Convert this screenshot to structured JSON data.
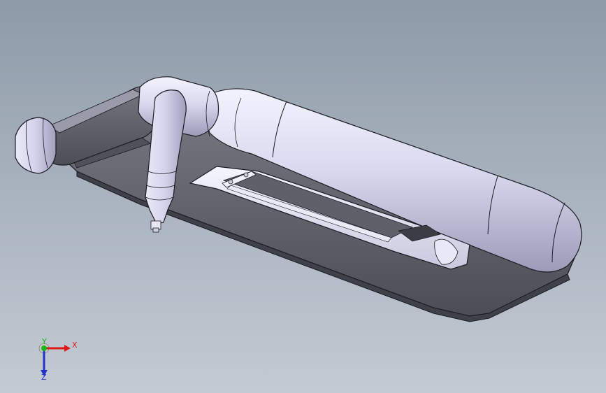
{
  "viewport": {
    "background_top": "#8e9aa8",
    "background_bottom": "#c3cad3"
  },
  "model": {
    "body_color": "#5b5d66",
    "tube_color": "#d8d8ec",
    "edge_color": "#1b1b22"
  },
  "triad": {
    "x_label": "X",
    "y_label": "Y",
    "z_label": "Z",
    "x_color": "#e01818",
    "y_color": "#17b817",
    "z_color": "#2233cc"
  }
}
